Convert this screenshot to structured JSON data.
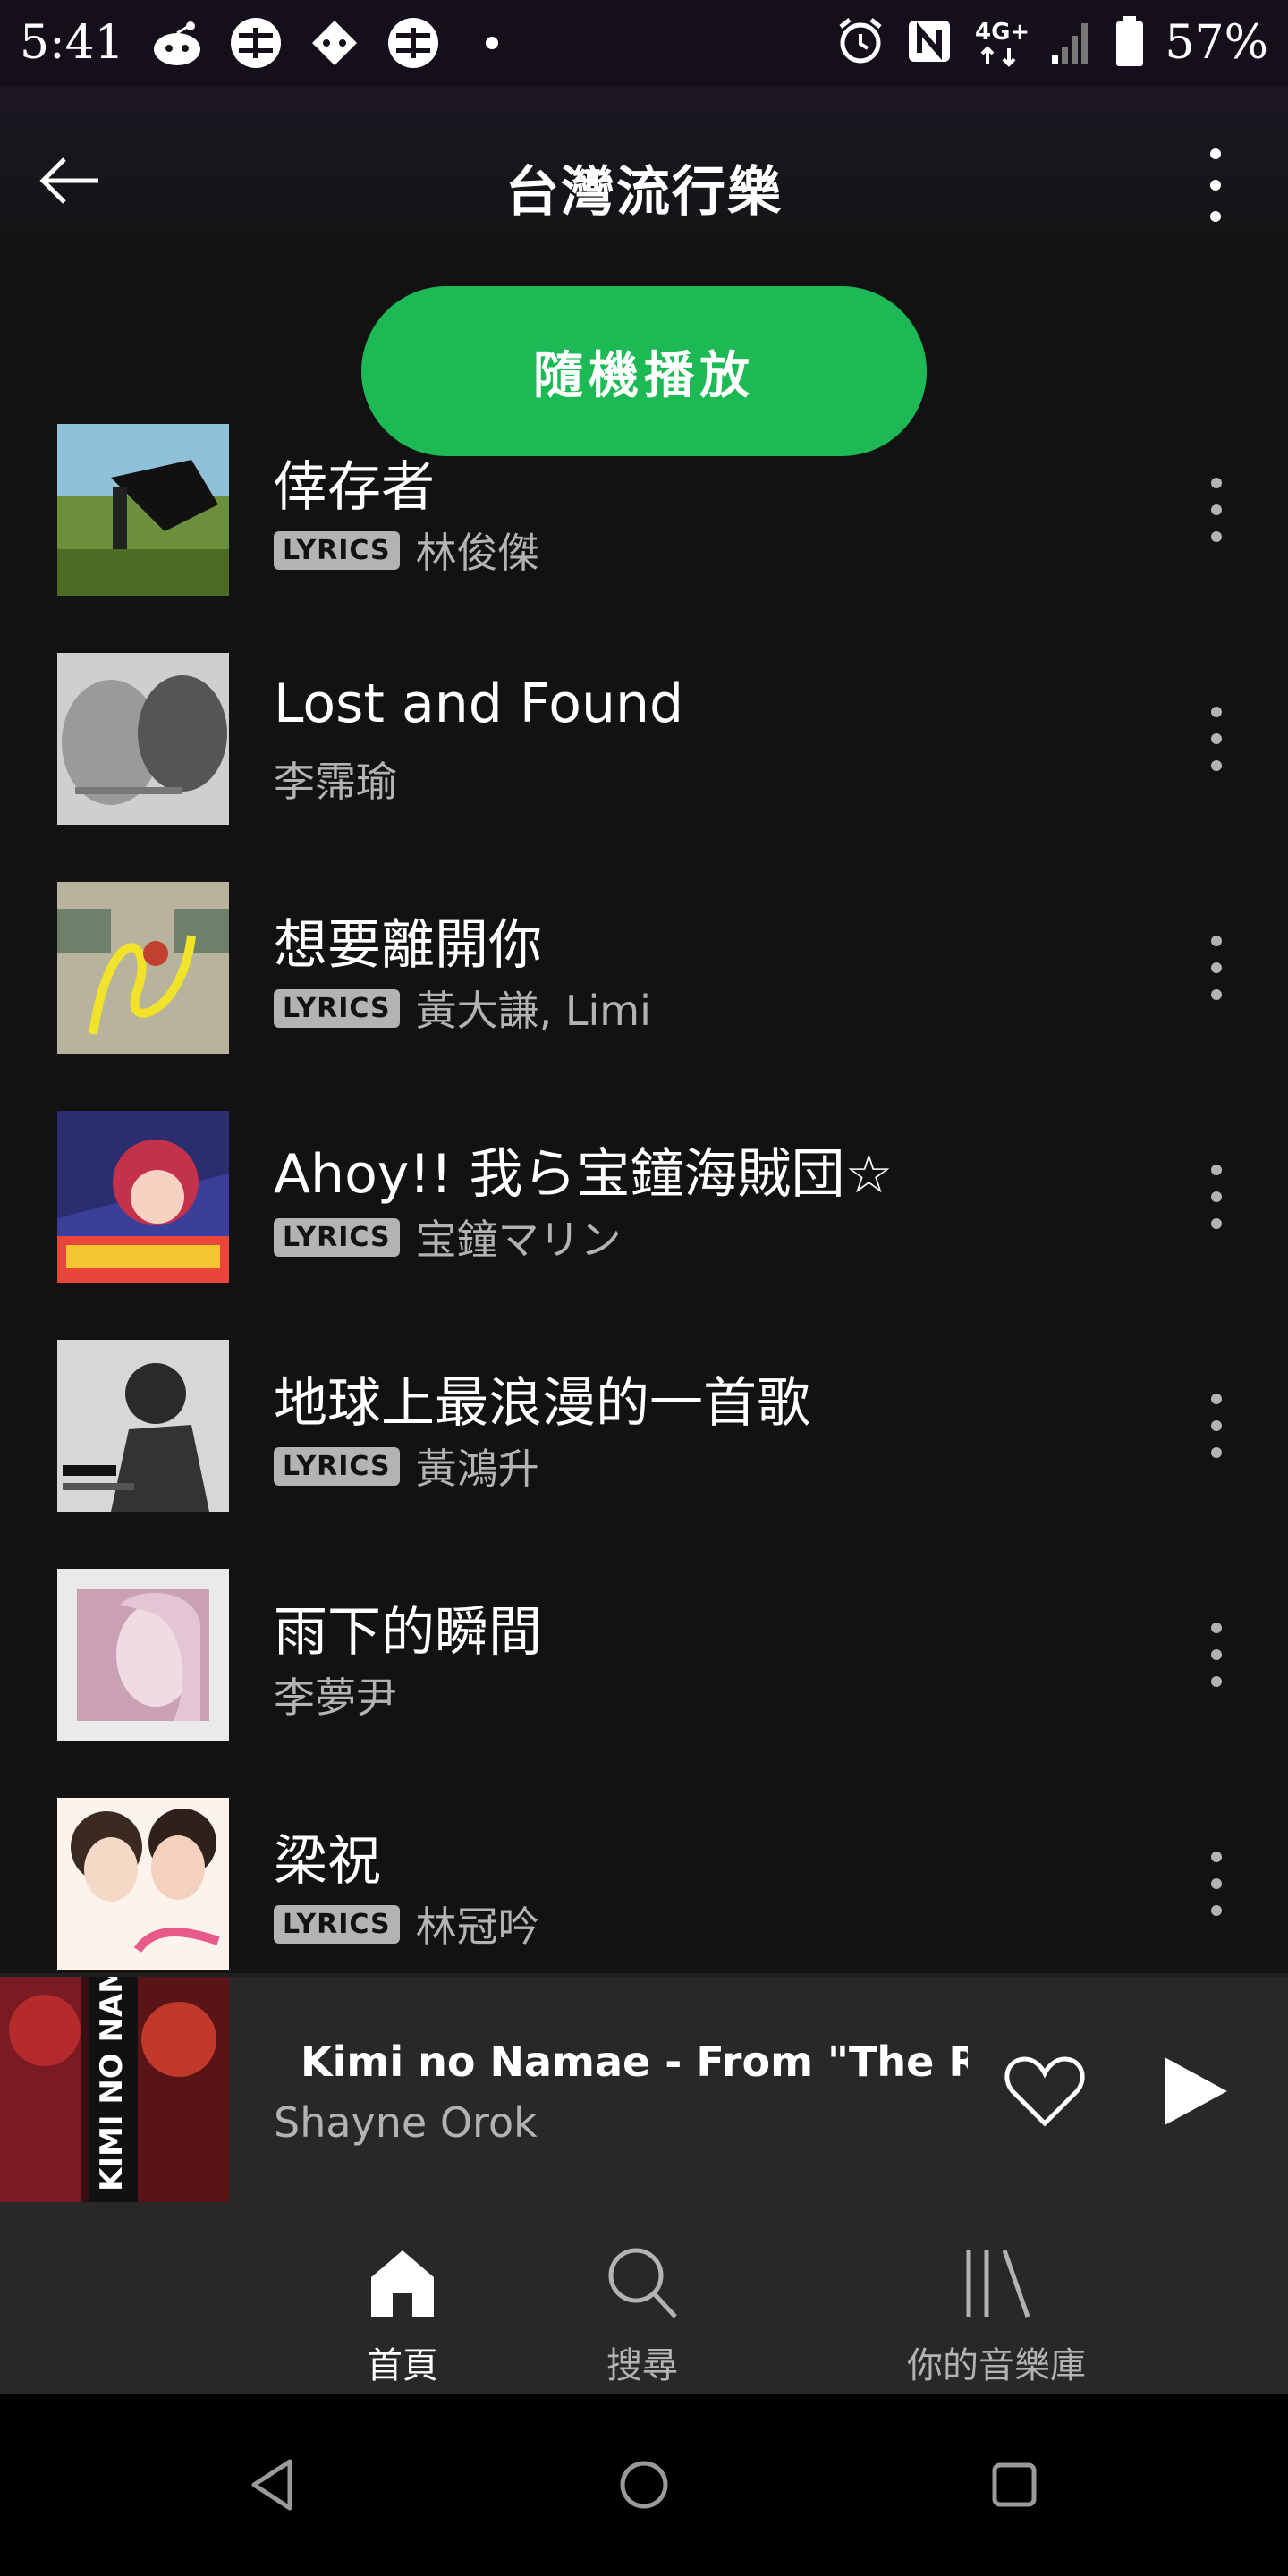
{
  "status_bar": {
    "time": "5:41",
    "battery": "57%",
    "network": "4G+"
  },
  "header": {
    "title": "台灣流行樂"
  },
  "shuffle_label": "隨機播放",
  "tracks": [
    {
      "title": "倖存者",
      "artist": "林俊傑",
      "lyrics": "LYRICS"
    },
    {
      "title": "Lost and Found",
      "artist": "李霈瑜",
      "lyrics": ""
    },
    {
      "title": "想要離開你",
      "artist": "黃大謙, Limi",
      "lyrics": "LYRICS"
    },
    {
      "title": "Ahoy!! 我ら宝鐘海賊団☆",
      "artist": "宝鐘マリン",
      "lyrics": "LYRICS"
    },
    {
      "title": "地球上最浪漫的一首歌",
      "artist": "黃鴻升",
      "lyrics": "LYRICS"
    },
    {
      "title": "雨下的瞬間",
      "artist": "李夢尹",
      "lyrics": ""
    },
    {
      "title": "梁祝",
      "artist": "林冠吟",
      "lyrics": "LYRICS"
    }
  ],
  "now_playing": {
    "title": "Kimi no Namae - From \"The Rising of the Shield Hero\"",
    "artist": "Shayne Orok",
    "cover_text": "KIMI NO NAMAE"
  },
  "bottom_nav": {
    "home": "首頁",
    "search": "搜尋",
    "library": "你的音樂庫"
  },
  "colors": {
    "accent": "#1db954",
    "background": "#121212",
    "bar": "#282828"
  }
}
